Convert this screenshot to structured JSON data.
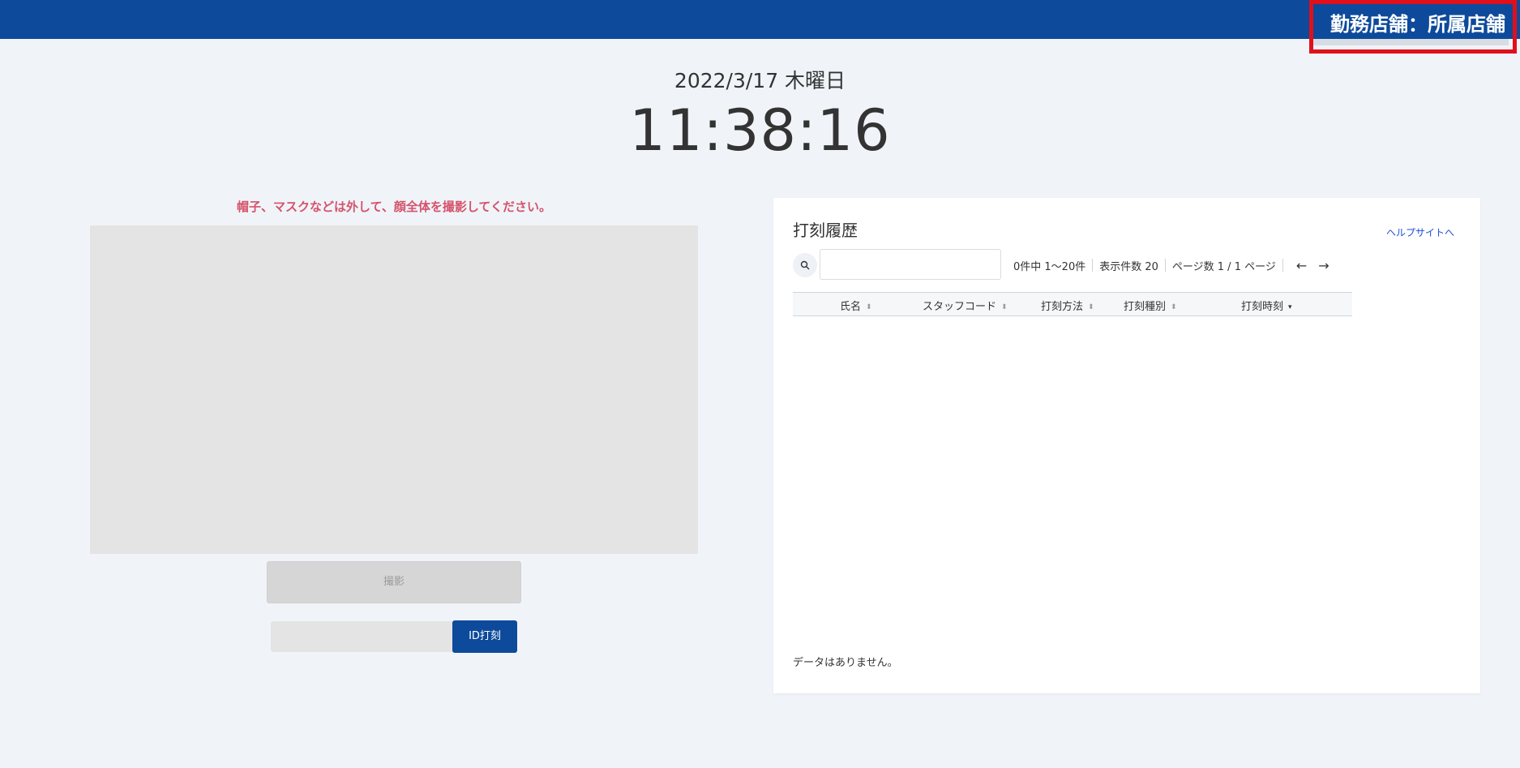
{
  "header": {
    "store_label": "勤務店舗：所属店舗",
    "accent_color": "#0d4a9b",
    "highlight_color": "#e0101b"
  },
  "datetime": {
    "date": "2022/3/17 木曜日",
    "time": "11:38:16"
  },
  "camera": {
    "notice": "帽子、マスクなどは外して、顔全体を撮影してください。",
    "shoot_button": "撮影",
    "id_input_value": "",
    "id_button": "ID打刻"
  },
  "history": {
    "title": "打刻履歴",
    "help_link": "ヘルプサイトへ",
    "search_value": "",
    "search_icon": "search-icon",
    "count_text": "0件中 1〜20件",
    "per_page_text": "表示件数 20",
    "pages_text": "ページ数 1 / 1 ページ",
    "prev_arrow": "←",
    "next_arrow": "→",
    "columns": [
      "氏名",
      "スタッフコード",
      "打刻方法",
      "打刻種別",
      "打刻時刻"
    ],
    "sort_icon": "⬍",
    "sort_active_icon": "▾",
    "empty_text": "データはありません。"
  }
}
